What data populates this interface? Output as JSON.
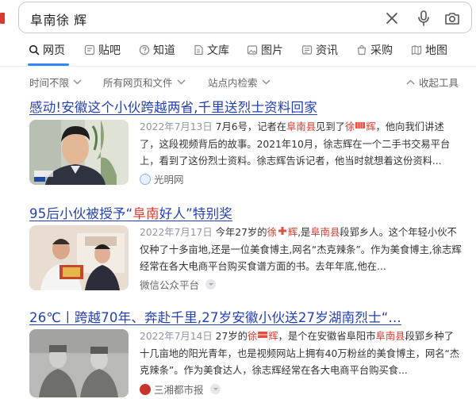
{
  "search": {
    "query": "阜南徐 辉"
  },
  "tabs": [
    {
      "label": "网页",
      "icon": "search-icon"
    },
    {
      "label": "贴吧",
      "icon": "tieba-icon"
    },
    {
      "label": "知道",
      "icon": "question-icon"
    },
    {
      "label": "文库",
      "icon": "document-icon"
    },
    {
      "label": "图片",
      "icon": "image-icon"
    },
    {
      "label": "资讯",
      "icon": "news-icon"
    },
    {
      "label": "采购",
      "icon": "shopping-bag-icon"
    },
    {
      "label": "地图",
      "icon": "map-icon"
    }
  ],
  "filters": {
    "time": "时间不限",
    "scope": "所有网页和文件",
    "site": "站点内检索",
    "collapse": "收起工具"
  },
  "results": [
    {
      "title_a": "感动!安徽这个小伙跨越两省,千里送烈士资料回家",
      "date": "2022年7月13日",
      "snippet_parts": [
        "7月6号，记者在",
        "阜南县",
        "见到了",
        "徐",
        "辉",
        "，他向我们讲述了，这段视频背后的故事。2021年10月，徐志辉在一个二手书交易平台上，看到了这份烈士资料。徐志辉告诉记者，他当时就想着这份资料..."
      ],
      "source": "光明网"
    },
    {
      "title_a": "95后小伙被授予“",
      "title_hl": "阜南",
      "title_b": "好人”特别奖",
      "date": "2022年7月17日",
      "snippet_parts": [
        "今年27岁的",
        "徐",
        "辉",
        ",是",
        "阜南县",
        "段郢乡人。这个年轻小伙不仅种了十多亩地,还是一位美食博主,网名“杰克辣条”。作为美食博主,徐志辉经常在各大电商平台购买食谱方面的书。去年年底,他在..."
      ],
      "source": "微信公众平台"
    },
    {
      "title_a": "26℃丨跨越70年、奔赴千里,27岁安徽小伙送27岁湖南烈士“...",
      "date": "2022年7月14日",
      "snippet_parts": [
        "27岁的",
        "徐",
        "辉",
        "，是个在安徽省阜阳市",
        "阜南县",
        "段郢乡种了十几亩地的阳光青年，也是视频网站上拥有40万粉丝的美食博主，网名“杰克辣条”。作为美食达人，徐志辉经常在各大电商平台购买食..."
      ],
      "source": "三湘都市报"
    }
  ],
  "colors": {
    "link": "#2440b3",
    "highlight": "#d93a2f",
    "accent": "#3385ff"
  }
}
